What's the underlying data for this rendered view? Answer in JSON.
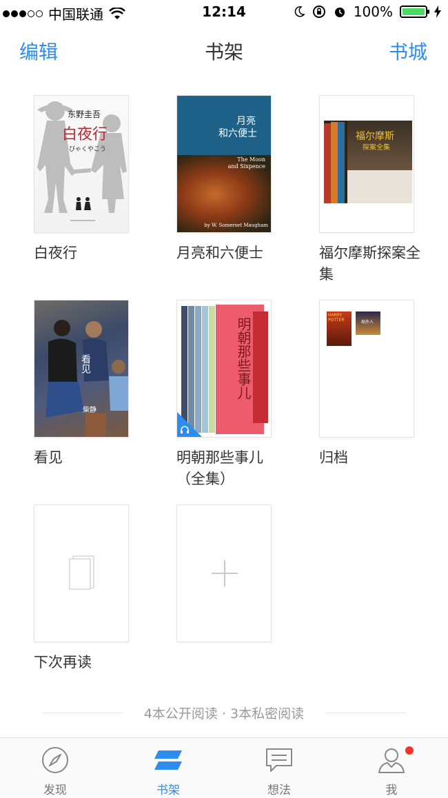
{
  "status_bar": {
    "carrier": "中国联通",
    "time": "12:14",
    "battery": "100%",
    "battery_level": 1.0
  },
  "nav": {
    "left": "编辑",
    "title": "书架",
    "right": "书城"
  },
  "books": [
    {
      "title": "白夜行",
      "cover_author": "东野圭吾",
      "cover_title": "白夜行",
      "cover_kana": "びゃくやこう"
    },
    {
      "title": "月亮和六便士",
      "cover_t1": "月亮",
      "cover_t2": "和六便士",
      "cover_t3": "The Moon\nand Sixpence",
      "cover_author": "by W. Somerset Maugham"
    },
    {
      "title": "福尔摩斯探案全集",
      "cover_title": "福尔摩斯",
      "cover_sub": "探案全集"
    },
    {
      "title": "看见",
      "cover_title": "看见",
      "cover_author": "柴静"
    },
    {
      "title": "明朝那些事儿（全集）",
      "cover_title": "明朝那些事儿"
    },
    {
      "title": "归档",
      "mini1": "HARRY POTTER",
      "mini2": "局外人"
    },
    {
      "title": "下次再读"
    }
  ],
  "summary": "4本公开阅读 · 3本私密阅读",
  "tabs": [
    {
      "label": "发现",
      "icon": "compass-icon"
    },
    {
      "label": "书架",
      "icon": "bookshelf-icon"
    },
    {
      "label": "想法",
      "icon": "chat-icon"
    },
    {
      "label": "我",
      "icon": "user-icon"
    }
  ],
  "colors": {
    "accent": "#2d8cf0",
    "badge": "#f0342f",
    "battery": "#4cd964"
  }
}
